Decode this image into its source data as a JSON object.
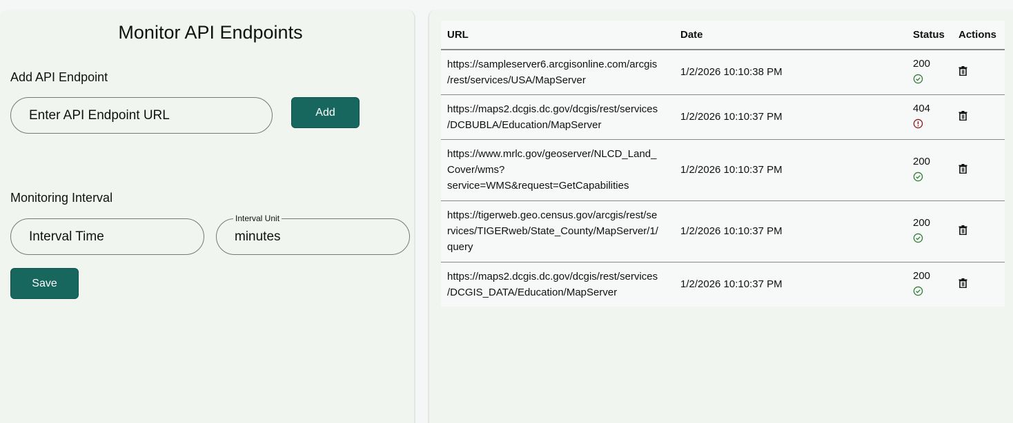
{
  "title": "Monitor API Endpoints",
  "add_section": {
    "label": "Add API Endpoint",
    "placeholder": "Enter API Endpoint URL",
    "add_label": "Add"
  },
  "interval_section": {
    "label": "Monitoring Interval",
    "time_placeholder": "Interval Time",
    "unit_label": "Interval Unit",
    "unit_value": "minutes",
    "save_label": "Save"
  },
  "table": {
    "headers": {
      "url": "URL",
      "date": "Date",
      "status": "Status",
      "actions": "Actions"
    },
    "rows": [
      {
        "url1": "https://sampleserver6.arcgisonline.com/arcgis",
        "url2": "/rest/services/USA/MapServer",
        "url3": "",
        "date": "1/2/2026 10:10:38 PM",
        "status": "200",
        "ok": true
      },
      {
        "url1": "https://maps2.dcgis.dc.gov/dcgis/rest/services",
        "url2": "/DCBUBLA/Education/MapServer",
        "url3": "",
        "date": "1/2/2026 10:10:37 PM",
        "status": "404",
        "ok": false
      },
      {
        "url1": "https://www.mrlc.gov/geoserver/NLCD_Land_",
        "url2": "Cover/wms?",
        "url3": "service=WMS&request=GetCapabilities",
        "date": "1/2/2026 10:10:37 PM",
        "status": "200",
        "ok": true
      },
      {
        "url1": "https://tigerweb.geo.census.gov/arcgis/rest/se",
        "url2": "rvices/TIGERweb/State_County/MapServer/1/",
        "url3": "query",
        "date": "1/2/2026 10:10:37 PM",
        "status": "200",
        "ok": true
      },
      {
        "url1": "https://maps2.dcgis.dc.gov/dcgis/rest/services",
        "url2": "/DCGIS_DATA/Education/MapServer",
        "url3": "",
        "date": "1/2/2026 10:10:37 PM",
        "status": "200",
        "ok": true
      }
    ]
  },
  "colors": {
    "accent": "#17675f",
    "ok": "#2e7d32",
    "error": "#8b1a1a"
  }
}
